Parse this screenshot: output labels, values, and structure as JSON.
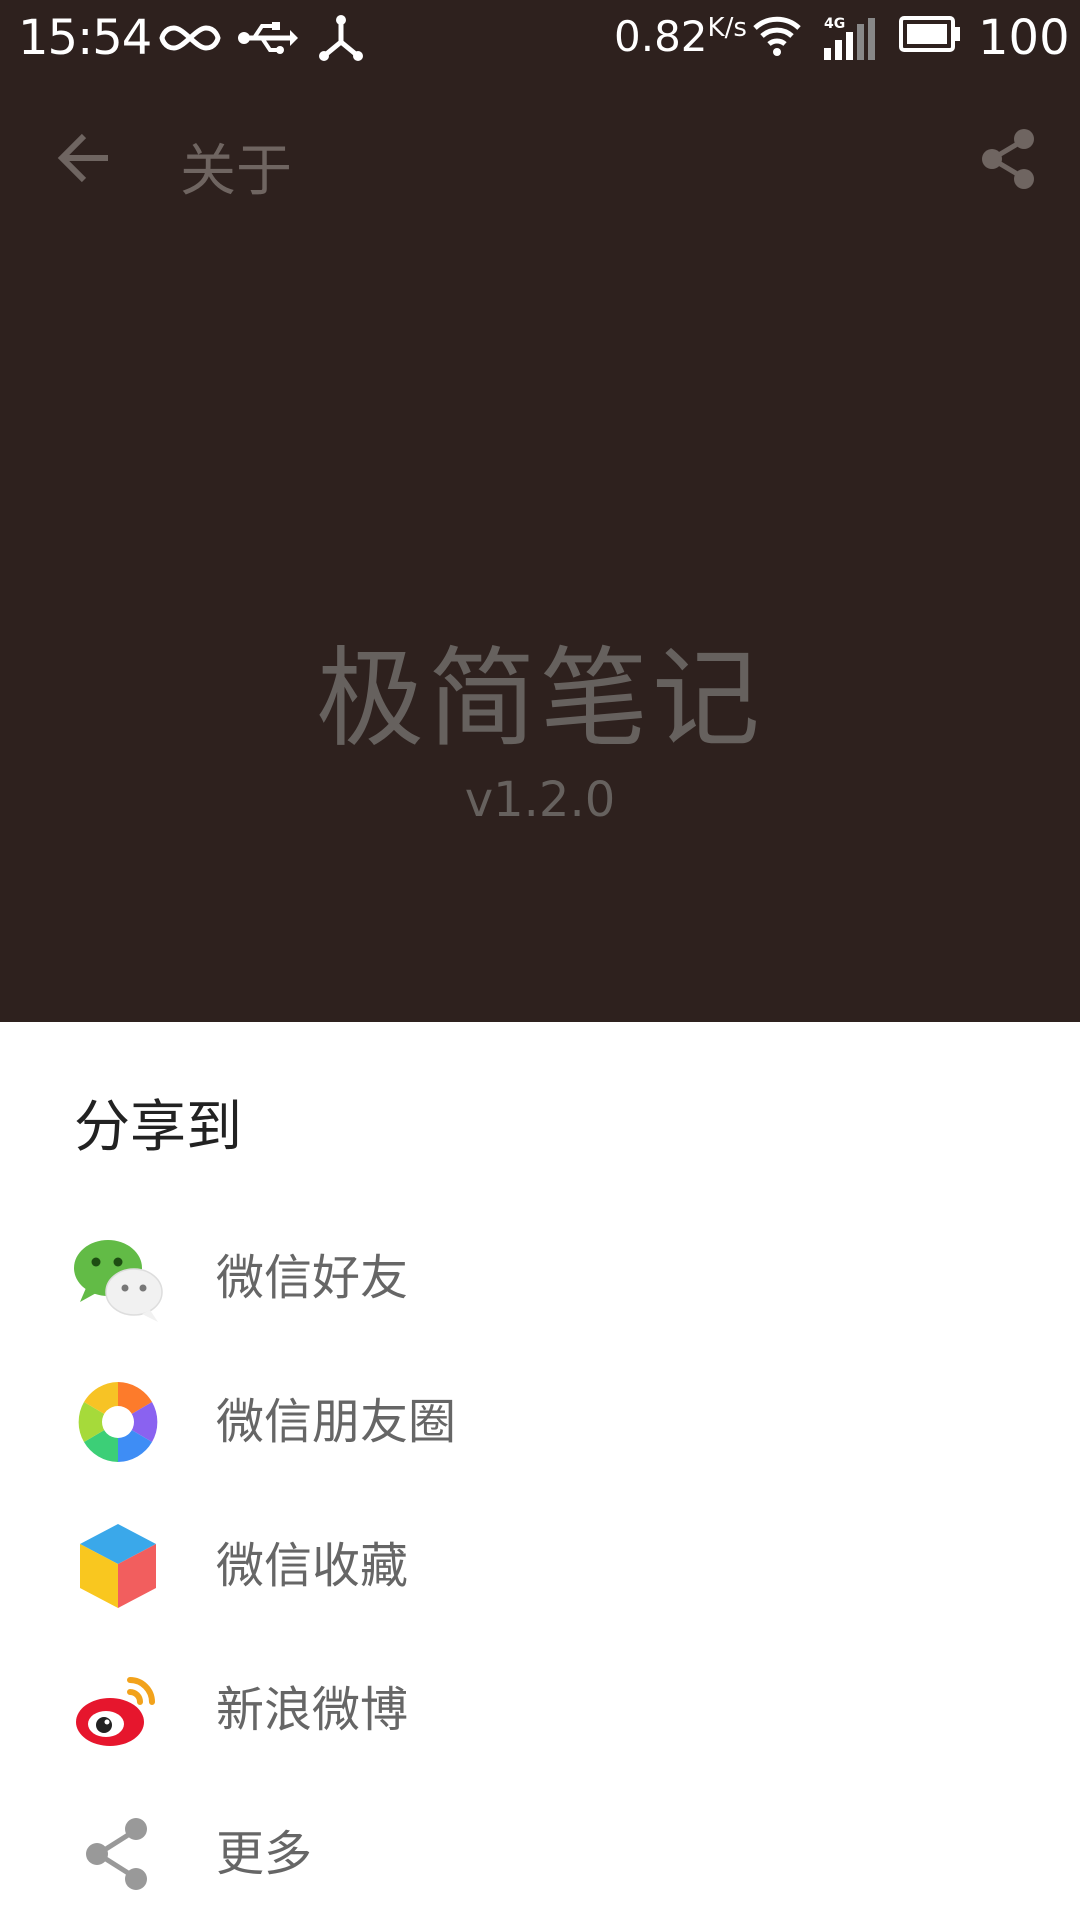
{
  "status_bar": {
    "time": "15:54",
    "speed": "0.82",
    "speed_unit": "K/s",
    "network": "4G",
    "battery": "100"
  },
  "app_bar": {
    "title": "关于",
    "back_icon": "arrow-back-icon",
    "share_icon": "share-icon"
  },
  "about": {
    "app_name": "极简笔记",
    "version": "v1.2.0"
  },
  "share_sheet": {
    "title": "分享到",
    "items": [
      {
        "label": "微信好友",
        "icon": "wechat-icon"
      },
      {
        "label": "微信朋友圈",
        "icon": "wechat-moments-icon"
      },
      {
        "label": "微信收藏",
        "icon": "wechat-favorites-icon"
      },
      {
        "label": "新浪微博",
        "icon": "weibo-icon"
      },
      {
        "label": "更多",
        "icon": "share-more-icon"
      }
    ]
  },
  "colors": {
    "background": "#2e211e",
    "sheet": "#ffffff",
    "dim_text": "#66615e"
  }
}
